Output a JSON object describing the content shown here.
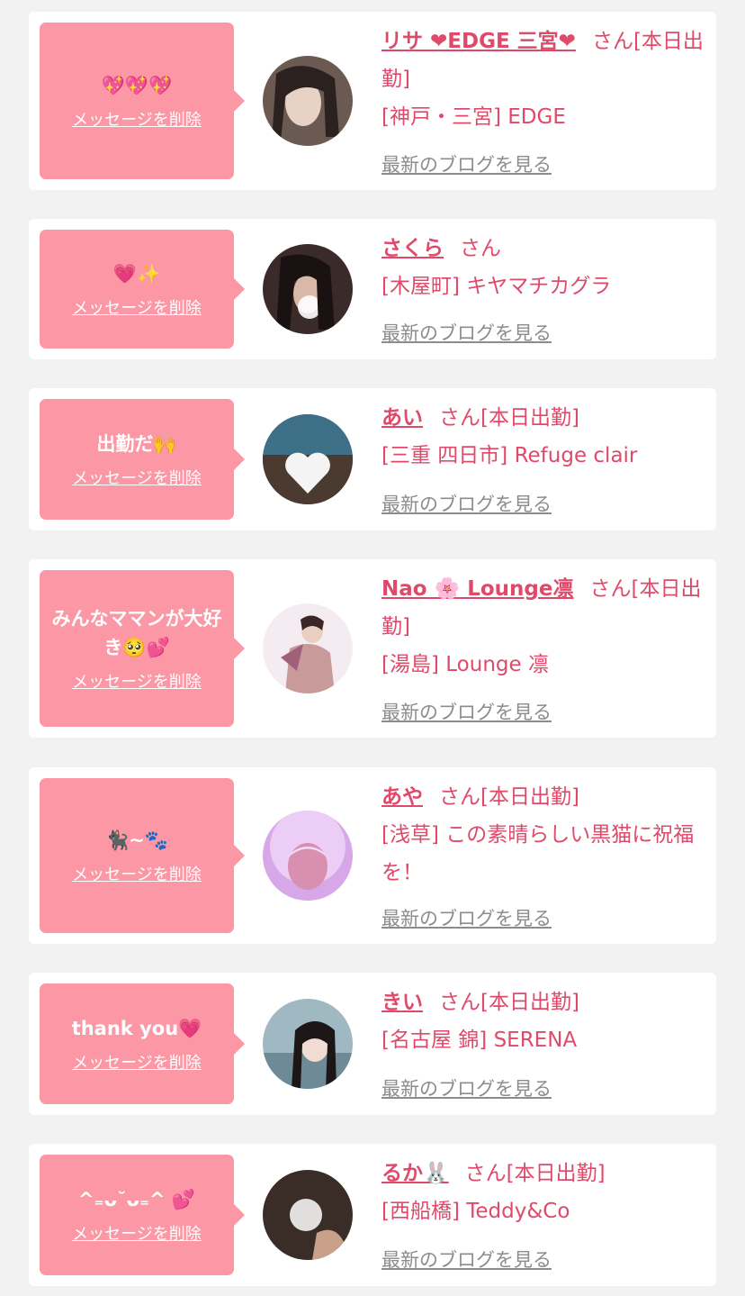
{
  "delete_label": "メッセージを削除",
  "blog_label": "最新のブログを見る",
  "colors": {
    "background": "#f2f2f2",
    "bubble": "#fc97a5",
    "accent": "#e04a6a",
    "link_gray": "#8c8c8c"
  },
  "messages": [
    {
      "message": "💖💖💖",
      "name": "リサ ❤EDGE 三宮❤",
      "suffix": "さん[本日出勤]",
      "shop": "[神戸・三宮] EDGE"
    },
    {
      "message": "💗✨",
      "name": "さくら",
      "suffix": "さん",
      "shop": "[木屋町] キヤマチカグラ"
    },
    {
      "message": "出勤だ🙌",
      "name": "あい",
      "suffix": "さん[本日出勤]",
      "shop": "[三重 四日市] Refuge clair"
    },
    {
      "message": "みんなママンが大好き🥺💕",
      "name": "Nao 🌸 Lounge凛",
      "suffix": "さん[本日出勤]",
      "shop": "[湯島] Lounge 凛"
    },
    {
      "message": "🐈‍⬛~🐾",
      "name": "あや",
      "suffix": "さん[本日出勤]",
      "shop": "[浅草] この素晴らしい黒猫に祝福を！"
    },
    {
      "message": "thank you💗",
      "name": "きい",
      "suffix": "さん[本日出勤]",
      "shop": "[名古屋 錦] SERENA"
    },
    {
      "message": "^₌ᴗ˘ᴗ₌^ 💕",
      "name": "るか🐰",
      "suffix": "さん[本日出勤]",
      "shop": "[西船橋] Teddy&Co"
    }
  ]
}
